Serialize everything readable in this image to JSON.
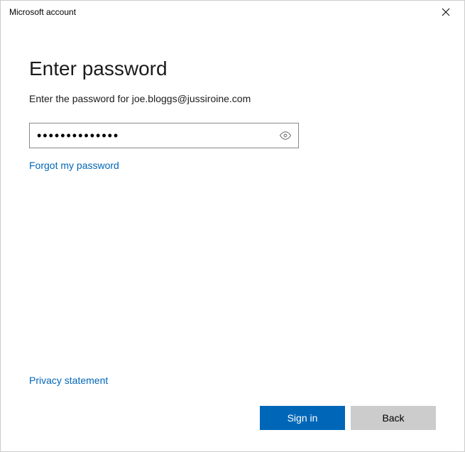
{
  "window": {
    "title": "Microsoft account"
  },
  "page": {
    "heading": "Enter password",
    "subtitle": "Enter the password for joe.bloggs@jussiroine.com"
  },
  "form": {
    "password_value": "••••••••••••••",
    "forgot_link": "Forgot my password"
  },
  "footer": {
    "privacy_link": "Privacy statement",
    "primary_button": "Sign in",
    "secondary_button": "Back"
  }
}
